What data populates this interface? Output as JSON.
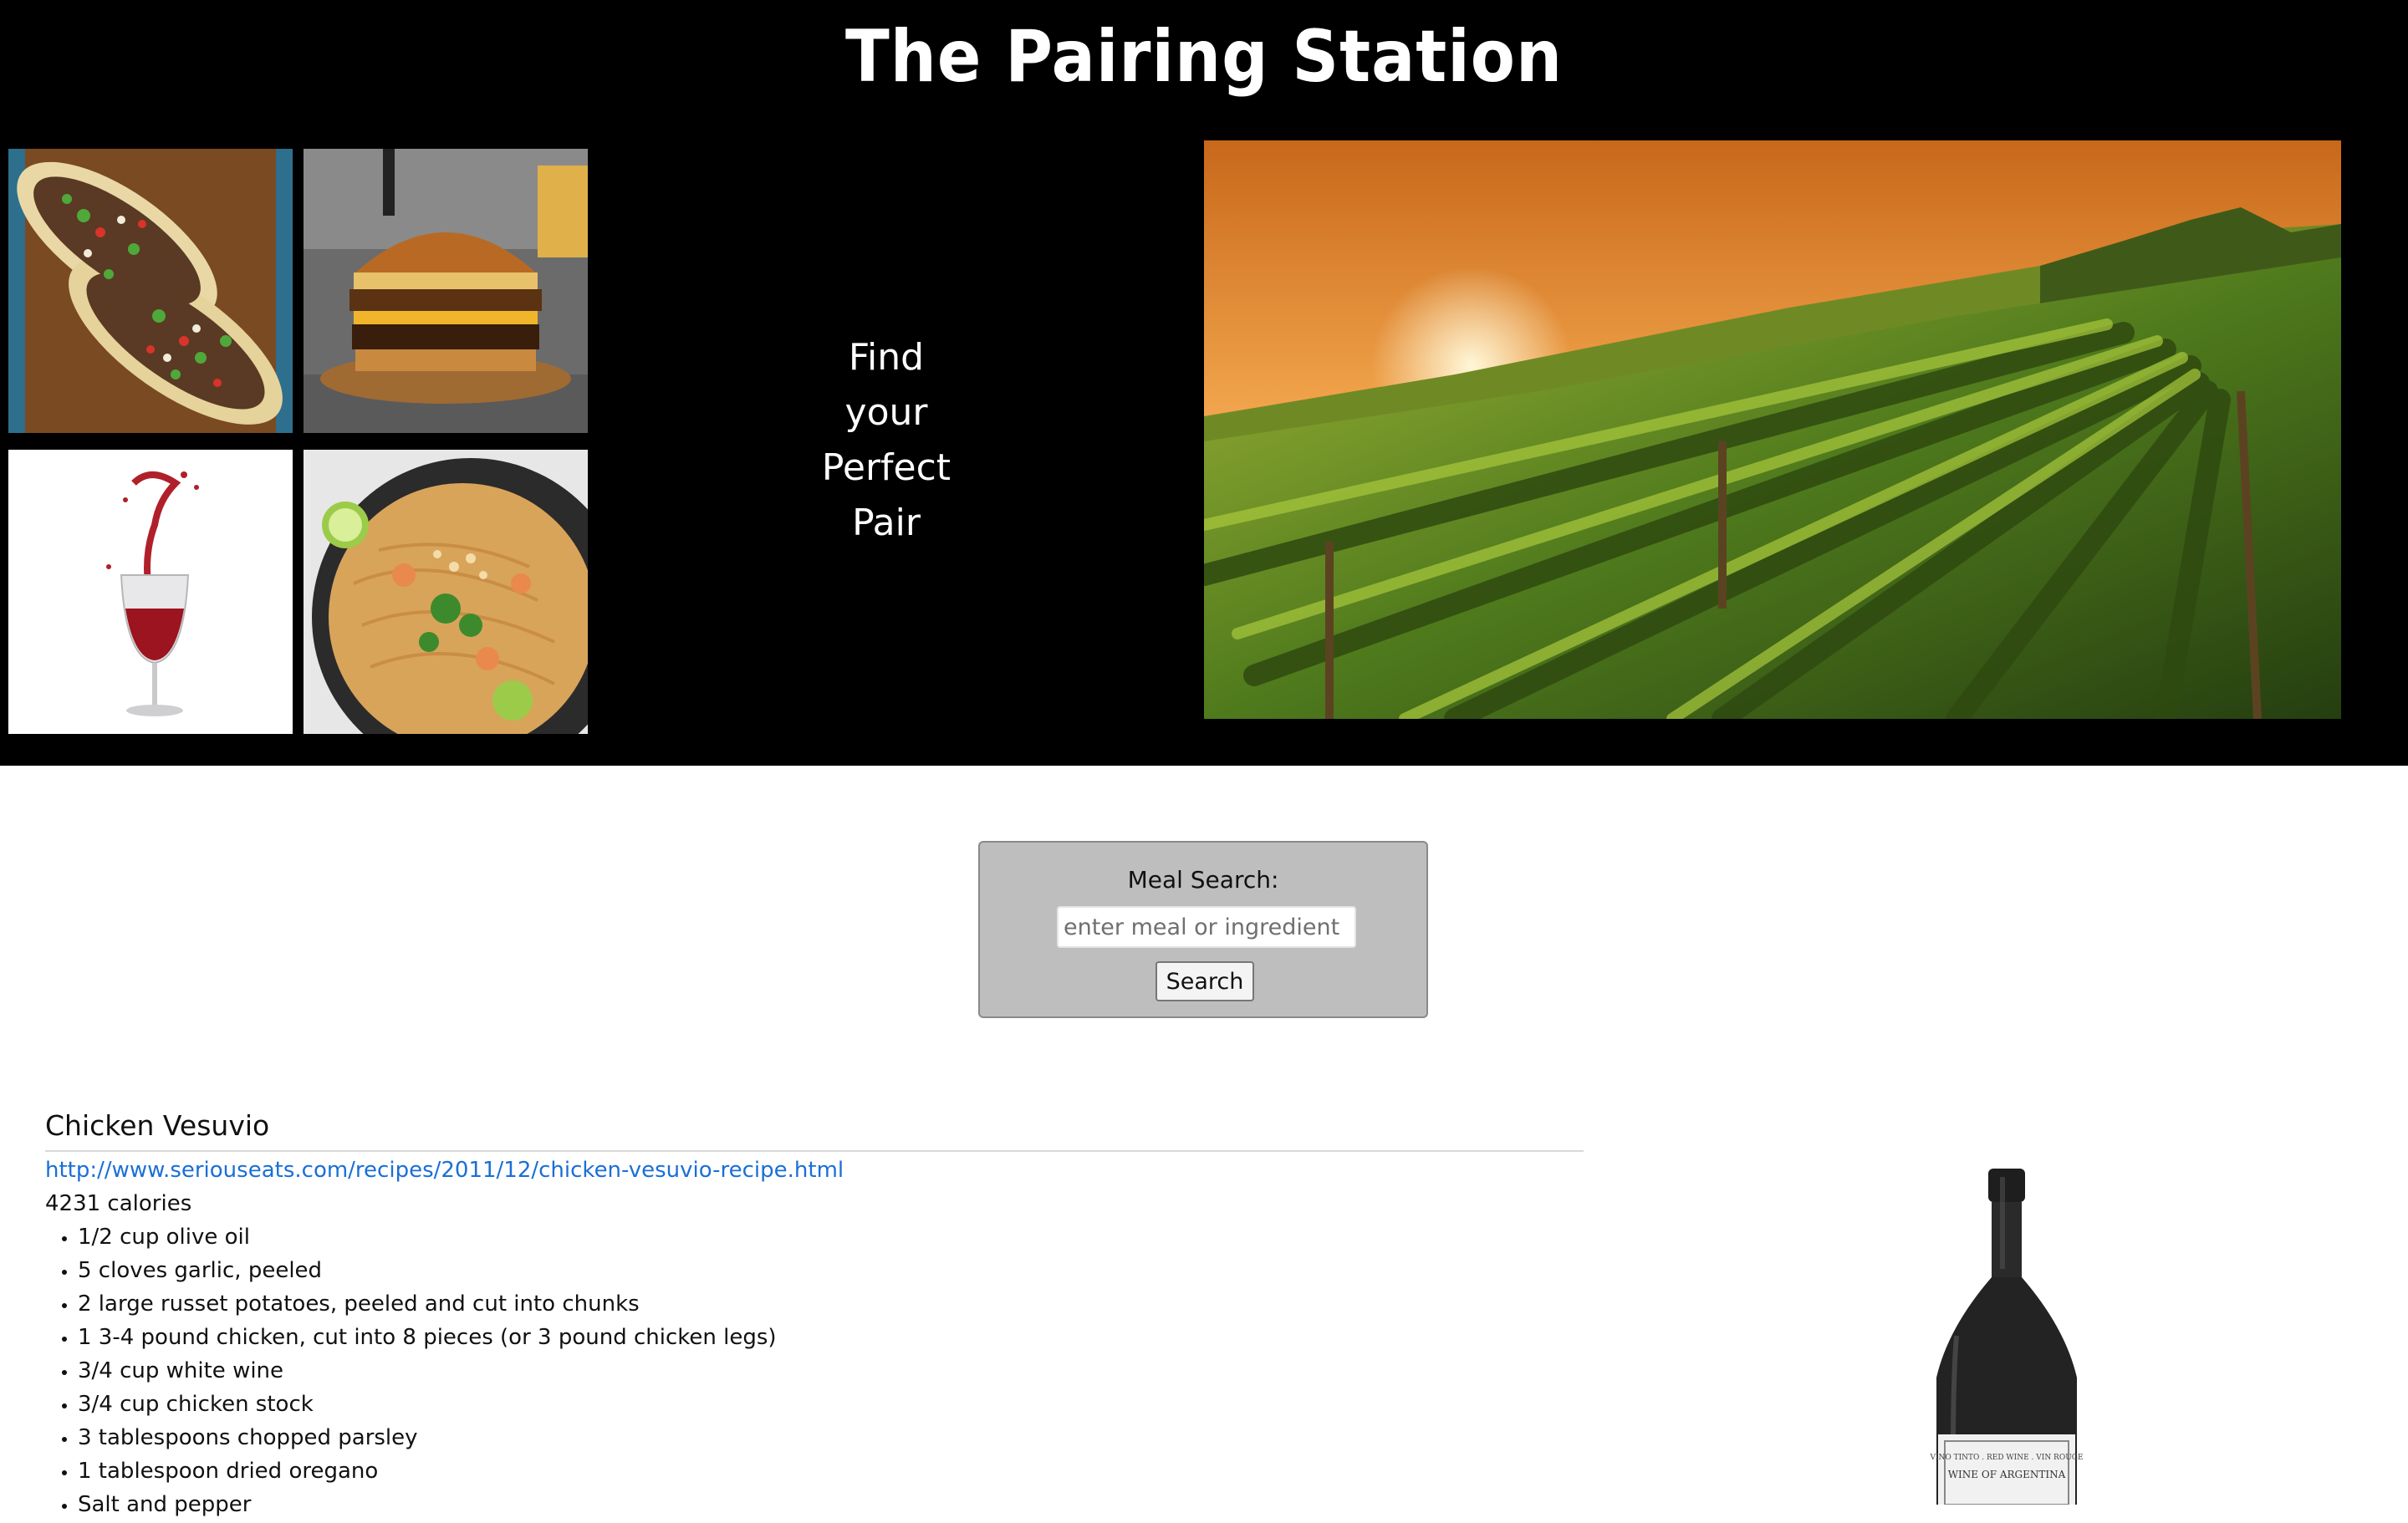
{
  "header": {
    "title": "The Pairing Station",
    "tagline_lines": [
      "Find",
      "your",
      "Perfect",
      "Pair"
    ]
  },
  "images": {
    "thumbs": [
      "tacos-photo",
      "burger-photo",
      "wine-glass-photo",
      "pad-thai-photo"
    ],
    "hero": "vineyard-sunset-photo",
    "bottle": "red-wine-bottle-photo",
    "bottle_label_text": [
      "VINO TINTO . RED WINE . VIN ROUGE",
      "WINE OF ARGENTINA"
    ]
  },
  "search": {
    "label": "Meal Search:",
    "placeholder": "enter meal or ingredient",
    "value": "",
    "button_label": "Search"
  },
  "recipe": {
    "title": "Chicken Vesuvio",
    "url": "http://www.seriouseats.com/recipes/2011/12/chicken-vesuvio-recipe.html",
    "calories": "4231 calories",
    "ingredients": [
      "1/2 cup olive oil",
      "5 cloves garlic, peeled",
      "2 large russet potatoes, peeled and cut into chunks",
      "1 3-4 pound chicken, cut into 8 pieces (or 3 pound chicken legs)",
      "3/4 cup white wine",
      "3/4 cup chicken stock",
      "3 tablespoons chopped parsley",
      "1 tablespoon dried oregano",
      "Salt and pepper"
    ]
  },
  "colors": {
    "hero_bg": "#000000",
    "search_box_bg": "#bebebe",
    "link": "#1a6fd6"
  }
}
